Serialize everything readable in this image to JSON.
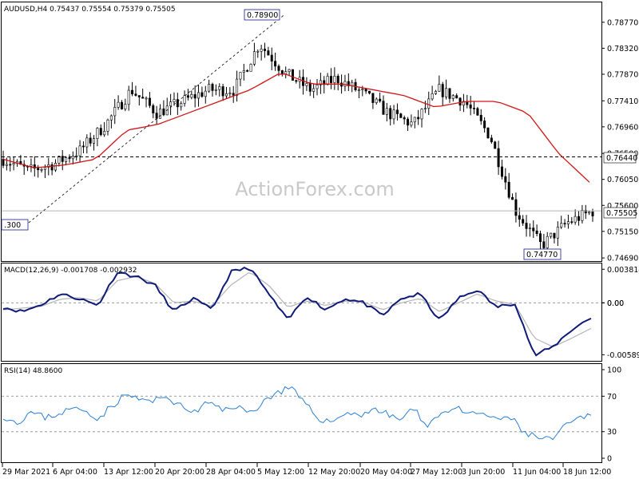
{
  "watermark": "ActionForex.com",
  "price_panel": {
    "header": "AUDUSD,H4  0.75437 0.75554 0.75379 0.75505",
    "y_ticks": [
      "0.78770",
      "0.78320",
      "0.77870",
      "0.77410",
      "0.76960",
      "0.76500",
      "0.76050",
      "0.75600",
      "0.75150",
      "0.74690"
    ],
    "level_labels": {
      "h_line": "0.76440",
      "current": "0.75505"
    },
    "annotations": {
      "high": "0.78900",
      "low": "0.74770",
      "start": ".300"
    }
  },
  "macd_panel": {
    "header": "MACD(12,26,9) -0.001708 -0.002932",
    "y_ticks": [
      "0.003814",
      "0.00",
      "0.00",
      "-0.005895"
    ]
  },
  "rsi_panel": {
    "header": "RSI(14) 48.8600",
    "y_ticks": [
      "100",
      "70",
      "30",
      "0"
    ]
  },
  "x_labels": [
    "29 Mar 2021",
    "6 Apr 04:00",
    "13 Apr 12:00",
    "20 Apr 20:00",
    "28 Apr 04:00",
    "5 May 12:00",
    "12 May 20:00",
    "20 May 04:00",
    "27 May 12:00",
    "3 Jun 20:00",
    "11 Jun 04:00",
    "18 Jun 12:00"
  ],
  "chart_data": [
    {
      "type": "candlestick",
      "symbol": "AUDUSD",
      "timeframe": "H4",
      "ohlc_last": {
        "open": 0.75437,
        "high": 0.75554,
        "low": 0.75379,
        "close": 0.75505
      },
      "ylim": [
        0.7465,
        0.791
      ],
      "x_points": [
        "29 Mar 2021",
        "6 Apr 04:00",
        "13 Apr 12:00",
        "20 Apr 20:00",
        "28 Apr 04:00",
        "5 May 12:00",
        "12 May 20:00",
        "20 May 04:00",
        "27 May 12:00",
        "3 Jun 20:00",
        "11 Jun 04:00",
        "18 Jun 12:00"
      ],
      "price_path": [
        0.764,
        0.762,
        0.7632,
        0.7655,
        0.77,
        0.776,
        0.772,
        0.774,
        0.776,
        0.776,
        0.784,
        0.7789,
        0.776,
        0.778,
        0.7755,
        0.772,
        0.77,
        0.776,
        0.774,
        0.768,
        0.755,
        0.749,
        0.753,
        0.755
      ],
      "moving_average": [
        0.764,
        0.7625,
        0.763,
        0.764,
        0.769,
        0.77,
        0.772,
        0.774,
        0.776,
        0.779,
        0.777,
        0.777,
        0.776,
        0.775,
        0.773,
        0.774,
        0.774,
        0.772,
        0.765,
        0.76
      ],
      "horizontal_line": 0.7644,
      "current_price": 0.75505,
      "trendline": [
        0.753,
        0.789
      ],
      "annotations": [
        {
          "label": "0.78900",
          "value": 0.789
        },
        {
          "label": "0.74770",
          "value": 0.7477
        }
      ]
    },
    {
      "type": "line",
      "indicator": "MACD(12,26,9)",
      "values_last": {
        "macd": -0.001708,
        "signal": -0.002932
      },
      "ylim": [
        -0.0065,
        0.0042
      ],
      "ref_line": 0,
      "macd": [
        -0.0005,
        -0.001,
        -0.0002,
        0.001,
        0.0005,
        -0.0003,
        0.0035,
        0.003,
        0.002,
        -0.001,
        0.0005,
        -0.0008,
        0.0035,
        0.004,
        0.001,
        -0.002,
        0.0008,
        -0.0008,
        0.0005,
        0.0,
        -0.0015,
        0.0005,
        0.001,
        -0.002,
        0.0005,
        0.0015,
        -0.0005,
        0.0,
        -0.006,
        -0.005,
        -0.003,
        -0.0017
      ],
      "signal": [
        -0.0008,
        -0.0006,
        -0.0004,
        0.0004,
        0.0006,
        0.0002,
        0.0025,
        0.003,
        0.0022,
        0.0,
        0.0002,
        -0.0004,
        0.002,
        0.0035,
        0.002,
        -0.0005,
        0.0002,
        -0.0003,
        0.0002,
        0.0001,
        -0.0008,
        0.0,
        0.0005,
        -0.001,
        0.0,
        0.001,
        0.0002,
        -0.0002,
        -0.004,
        -0.005,
        -0.004,
        -0.0029
      ]
    },
    {
      "type": "line",
      "indicator": "RSI(14)",
      "value_last": 48.86,
      "ylim": [
        0,
        100
      ],
      "ref_lines": [
        70,
        30
      ],
      "rsi": [
        48,
        40,
        52,
        46,
        50,
        56,
        54,
        45,
        60,
        72,
        66,
        64,
        70,
        58,
        52,
        63,
        54,
        60,
        50,
        64,
        74,
        80,
        62,
        46,
        40,
        52,
        48,
        56,
        50,
        44,
        55,
        38,
        50,
        58,
        48,
        52,
        42,
        48,
        30,
        24,
        20,
        34,
        44,
        49
      ]
    }
  ]
}
